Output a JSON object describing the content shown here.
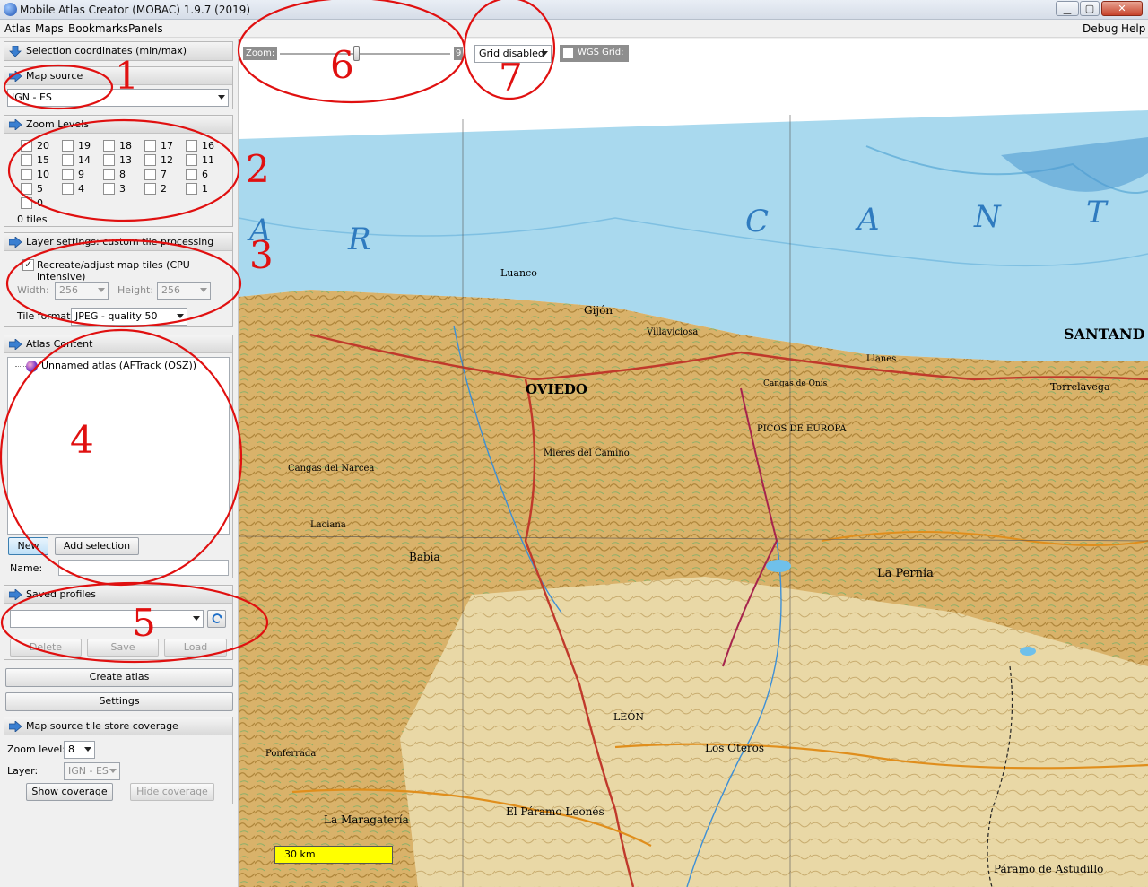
{
  "window": {
    "title": "Mobile Atlas Creator (MOBAC) 1.9.7 (2019)",
    "min_label": "▁",
    "max_label": "▢",
    "close_label": "✕"
  },
  "menubar": {
    "left": [
      "Atlas",
      "Maps",
      "Bookmarks",
      "Panels"
    ],
    "right": [
      "Debug",
      "Help"
    ]
  },
  "selection_coordinates": {
    "title": "Selection coordinates (min/max)"
  },
  "map_source": {
    "title": "Map source",
    "selected": "IGN - ES"
  },
  "zoom_levels": {
    "title": "Zoom Levels",
    "levels": [
      "20",
      "19",
      "18",
      "17",
      "16",
      "15",
      "14",
      "13",
      "12",
      "11",
      "10",
      "9",
      "8",
      "7",
      "6",
      "5",
      "4",
      "3",
      "2",
      "1",
      "0"
    ],
    "tiles_label": "0 tiles"
  },
  "layer_settings": {
    "title": "Layer settings: custom tile processing",
    "recreate_label": "Recreate/adjust map tiles (CPU intensive)",
    "recreate_checked": true,
    "width_label": "Width:",
    "width_value": "256",
    "height_label": "Height:",
    "height_value": "256",
    "tile_format_label": "Tile format:",
    "tile_format_value": "JPEG - quality 50"
  },
  "atlas_content": {
    "title": "Atlas Content",
    "tree_item": "Unnamed atlas (AFTrack (OSZ))",
    "new_label": "New",
    "add_selection_label": "Add selection",
    "name_label": "Name:",
    "name_value": ""
  },
  "saved_profiles": {
    "title": "Saved profiles",
    "selected": "",
    "delete_label": "Delete",
    "save_label": "Save",
    "load_label": "Load"
  },
  "create_atlas_label": "Create atlas",
  "settings_label": "Settings",
  "coverage": {
    "title": "Map source tile store coverage",
    "zoom_label": "Zoom level:",
    "zoom_value": "8",
    "layer_label": "Layer:",
    "layer_value": "IGN - ES",
    "show_label": "Show coverage",
    "hide_label": "Hide coverage"
  },
  "map_toolbar": {
    "zoom_label": "Zoom:",
    "zoom_value_text": "9",
    "zoom_level": 9,
    "grid_selected": "Grid disabled",
    "wgs_grid_label": "WGS Grid:"
  },
  "map": {
    "scale_label": "30 km",
    "place_labels": [
      "SANTAND",
      "OVIEDO",
      "Gijón",
      "Luanco",
      "Villaviciosa",
      "Llanes",
      "Torrelavega",
      "Cangas de Onís",
      "Cangas del Narcea",
      "Mieres del Camino",
      "PICOS DE EUROPA",
      "La Pernía",
      "Los Oteros",
      "El Páramo Leonés",
      "LEÓN",
      "Ponferrada",
      "La Maragatería",
      "Babia",
      "Páramo de Astudillo",
      "Laciana"
    ],
    "sea_letters": [
      "A",
      "R",
      "C",
      "A",
      "N",
      "T"
    ]
  },
  "annotations": [
    "1",
    "2",
    "3",
    "4",
    "5",
    "6",
    "7"
  ],
  "colors": {
    "annotation": "#e01010",
    "scale_bar": "#ffff00",
    "sea": "#a9d9ee",
    "land": "#d9b26a"
  }
}
